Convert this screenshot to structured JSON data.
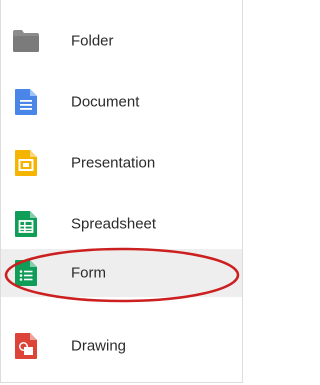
{
  "menu": {
    "items": [
      {
        "label": "Folder",
        "icon": "folder-icon",
        "color": "#8c8c8c"
      },
      {
        "label": "Document",
        "icon": "document-icon",
        "color": "#4a86e8"
      },
      {
        "label": "Presentation",
        "icon": "presentation-icon",
        "color": "#f4b400"
      },
      {
        "label": "Spreadsheet",
        "icon": "spreadsheet-icon",
        "color": "#0f9d58"
      },
      {
        "label": "Form",
        "icon": "form-icon",
        "color": "#0f9d58",
        "highlighted": true
      },
      {
        "label": "Drawing",
        "icon": "drawing-icon",
        "color": "#db4437"
      }
    ]
  },
  "colors": {
    "hover_background": "#eeeeee",
    "annotation_circle": "#cc1f1f",
    "border": "#dcdcdc"
  }
}
